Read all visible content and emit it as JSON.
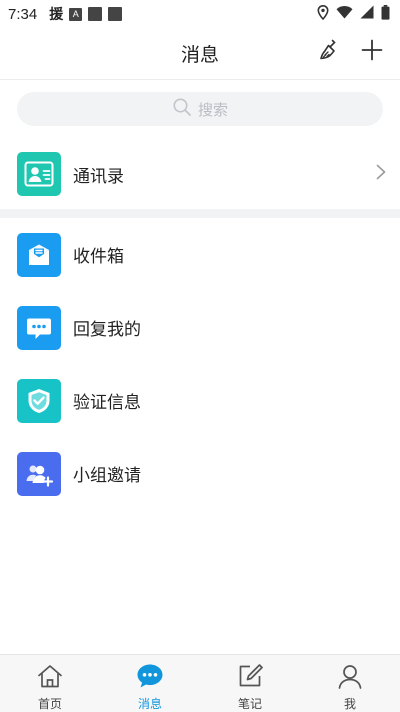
{
  "status_bar": {
    "time": "7:34",
    "glyph_label": "援",
    "glyph_a": "A"
  },
  "header": {
    "title": "消息",
    "actions": [
      {
        "name": "clean-icon"
      },
      {
        "name": "add-icon"
      }
    ]
  },
  "search": {
    "placeholder": "搜索"
  },
  "contacts": {
    "label": "通讯录",
    "icon": "contact-card-icon",
    "color": "#1fc7b0"
  },
  "list": [
    {
      "label": "收件箱",
      "icon": "inbox-envelope-icon",
      "color": "#1a9df0"
    },
    {
      "label": "回复我的",
      "icon": "chat-bubble-icon",
      "color": "#1a9df0"
    },
    {
      "label": "验证信息",
      "icon": "shield-check-icon",
      "color": "#17c3c6"
    },
    {
      "label": "小组邀请",
      "icon": "group-add-icon",
      "color": "#4a6df0"
    }
  ],
  "tabs": [
    {
      "label": "首页",
      "icon": "home-icon",
      "active": false
    },
    {
      "label": "消息",
      "icon": "message-icon",
      "active": true
    },
    {
      "label": "笔记",
      "icon": "note-edit-icon",
      "active": false
    },
    {
      "label": "我",
      "icon": "user-icon",
      "active": false
    }
  ],
  "colors": {
    "accent": "#1296db",
    "text": "#222222",
    "search_bg": "#f2f3f5"
  }
}
